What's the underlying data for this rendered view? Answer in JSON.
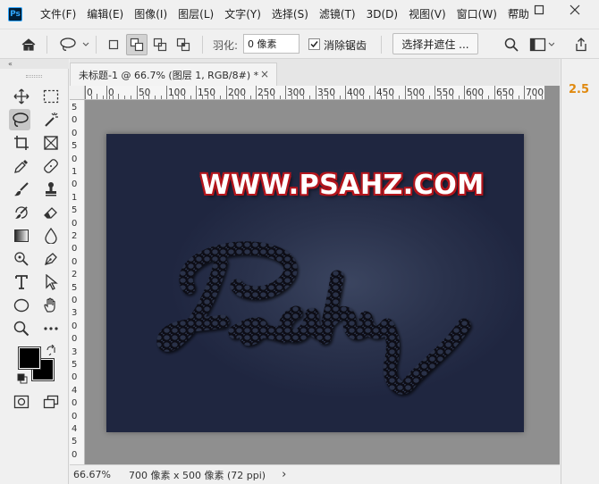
{
  "app": {
    "logo": "Ps"
  },
  "menu": [
    "文件(F)",
    "编辑(E)",
    "图像(I)",
    "图层(L)",
    "文字(Y)",
    "选择(S)",
    "滤镜(T)",
    "3D(D)",
    "视图(V)",
    "窗口(W)",
    "帮助"
  ],
  "window_controls": [
    "minimize-icon",
    "maximize-icon",
    "close-icon"
  ],
  "options": {
    "feather_label": "羽化:",
    "feather_value": "0 像素",
    "antialias_label": "消除锯齿",
    "antialias_checked": true,
    "select_mask_label": "选择并遮住 ..."
  },
  "collapse_glyph": "«",
  "document": {
    "tab_title": "未标题-1 @ 66.7% (图层 1, RGB/8#) *",
    "close_glyph": "×",
    "watermark": "WWW.PSAHZ.COM",
    "script_text": "Psahz"
  },
  "ruler": {
    "h_labels": [
      "0",
      "0",
      "50",
      "100",
      "150",
      "200",
      "250",
      "300",
      "350",
      "400",
      "450",
      "500",
      "550",
      "600",
      "650",
      "700"
    ],
    "v_labels": [
      "5",
      "0",
      "0",
      "5",
      "0",
      "1",
      "0",
      "1",
      "5",
      "0",
      "2",
      "0",
      "0",
      "2",
      "5",
      "0",
      "3",
      "0",
      "0",
      "3",
      "5",
      "0",
      "4",
      "0",
      "0",
      "4",
      "5",
      "0"
    ]
  },
  "status": {
    "zoom": "66.67%",
    "doc_info": "700 像素 x 500 像素 (72 ppi)",
    "arrow": "›"
  },
  "right_panel": {
    "value": "2.5"
  },
  "colors": {
    "foreground": "#000000",
    "background": "#000000",
    "canvas_bg": "#252c44",
    "watermark_outline": "#b3151c",
    "accent": "#e08a10"
  }
}
